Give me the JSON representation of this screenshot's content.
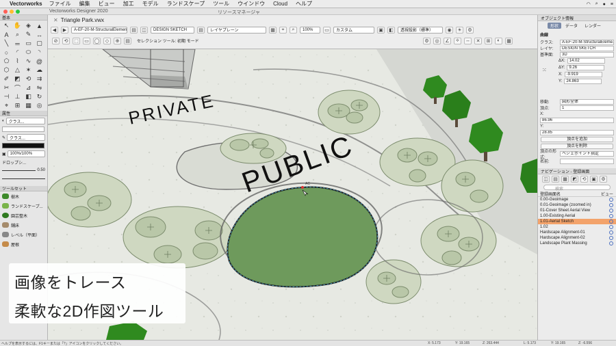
{
  "menubar": {
    "app": "Vectorworks",
    "items": [
      "ファイル",
      "編集",
      "ビュー",
      "加工",
      "モデル",
      "ランドスケープ",
      "ツール",
      "ウインドウ",
      "Cloud",
      "ヘルプ"
    ]
  },
  "window": {
    "title": "Vectorworks Designer 2020",
    "resource_manager": "リソースマネージャ"
  },
  "document": {
    "tab": "Triangle Park.vwx",
    "class_select": "A-EF-20-M-StructuralElemen...",
    "layer_select": "DESIGN SKETCH",
    "layer_plane": "レイヤプレーン",
    "zoom": "100%",
    "custom": "カスタム",
    "render_mode": "透視投影（標準）",
    "mode_bar": "セレクション ツール: 初期 モード"
  },
  "left_panels": {
    "basic": "基本",
    "attributes": "属性",
    "class_fill": "クラス...",
    "class_pen": "クラス...",
    "opacity": "100%/100%",
    "dropshadow": "ドロップシ...",
    "line_weight": "0.50",
    "toolset": "ツールセット",
    "tools": [
      "樹木",
      "ランドスケープ...",
      "園芸整木",
      "舗床",
      "レベル（平面）",
      "屋根"
    ]
  },
  "canvas": {
    "label_private": "PRIVATE",
    "label_public": "PUBLIC",
    "tooltip": "AC"
  },
  "caption": {
    "line1": "画像をトレース",
    "line2": "柔軟な2D作図ツール"
  },
  "object_info": {
    "title": "オブジェクト情報",
    "tabs": [
      "形状",
      "データ",
      "レンダー"
    ],
    "kind": "曲線",
    "class_label": "クラス:",
    "class_value": "A-EF-20-M-StructuralEleme...",
    "layer_label": "レイヤ:",
    "layer_value": "DESIGN SKETCH",
    "plane_label": "基準面:",
    "plane_value": "3D",
    "dx_label": "ΔX:",
    "dx_value": "14.02",
    "dy_label": "ΔY:",
    "dy_value": "9.26",
    "x_label": "X:",
    "x_value": "-9.919",
    "y_label": "Y:",
    "y_value": "24.863",
    "move_label": "移動:",
    "move_value": "図形全体",
    "vertex_label": "頂点:",
    "vertex_value": "1",
    "vx_label": "X:",
    "vx_value": "86.96",
    "vy_label": "Y:",
    "vy_value": "28.85",
    "add_vertex": "頂点を追加",
    "delete_vertex": "頂点を削除",
    "vertex_type_label": "頂点の形式:",
    "vertex_type_value": "ベジェポイント指定",
    "name_label": "名前:"
  },
  "navigation": {
    "title": "ナビゲーション - 登録画面",
    "search_placeholder": "検索",
    "col_name": "登録画面名",
    "col_view": "ビュー",
    "items": [
      "0.00-Geoimage",
      "0.01-Geoimage (zoomed in)",
      "01-Cover Sheet Aerial View",
      "1.00-Existing Aerial",
      "1.01-Aerial Sketch",
      "1.02",
      "Hardscape Alignment-01",
      "Hardscape Alignment-02",
      "Landscape Plant Massing"
    ],
    "active_index": 4
  },
  "status": {
    "hint": "ヘルプを表示するには、F1キーまたは「?」アイコンをクリックしてください。",
    "x": "X: 5.173",
    "y": "Y: 19.165",
    "z": "Z: 263.444",
    "lx": "L: 5.173",
    "ly": "Y: 19.165",
    "lz": "Z: -6.556"
  },
  "colors": {
    "accent_row": "#f3a36b",
    "selection_fill": "#6e9a5c",
    "tree_green": "#2f8a1f"
  }
}
